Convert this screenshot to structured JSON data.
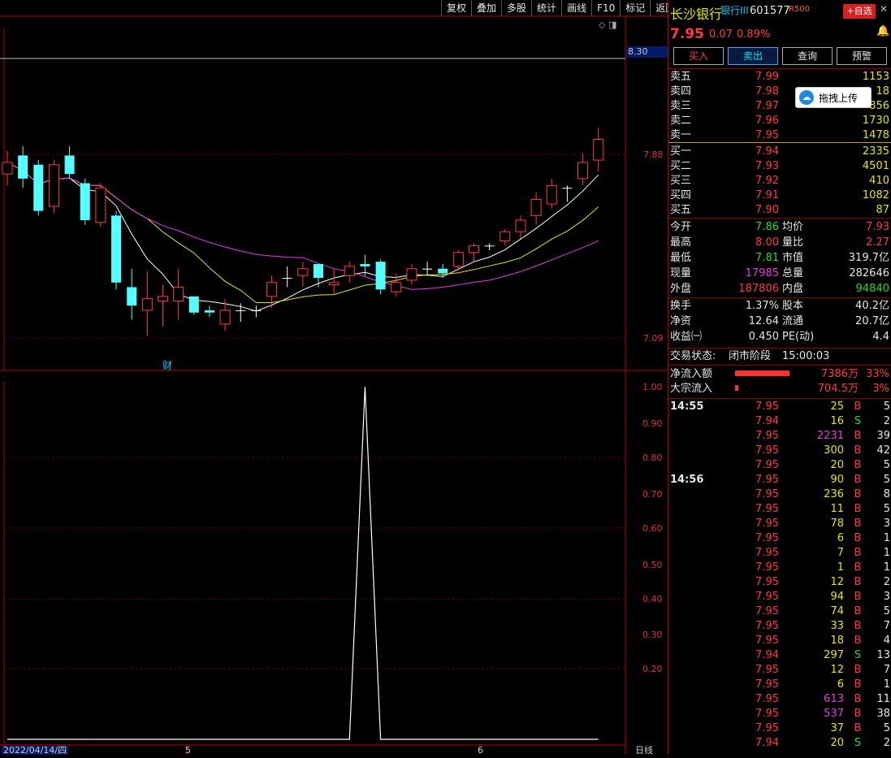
{
  "toolbar": [
    "复权",
    "叠加",
    "多股",
    "统计",
    "画线",
    "F10",
    "标记",
    "返回"
  ],
  "chart": {
    "price_axis": [
      "8.30",
      "7.88",
      "7.09"
    ],
    "indicator_axis": [
      "1.00",
      "0.90",
      "0.80",
      "0.70",
      "0.60",
      "0.50",
      "0.40",
      "0.30",
      "0.20"
    ],
    "date_label": "2022/04/14/四",
    "month_labels": [
      "5",
      "6"
    ],
    "finance_marker": "财",
    "period": "日线",
    "current_price_tag": "8.30"
  },
  "chart_data": {
    "type": "candlestick",
    "candles": [
      {
        "o": 7.8,
        "c": 7.85,
        "h": 7.9,
        "l": 7.75
      },
      {
        "o": 7.88,
        "c": 7.78,
        "h": 7.92,
        "l": 7.74
      },
      {
        "o": 7.84,
        "c": 7.64,
        "h": 7.86,
        "l": 7.62
      },
      {
        "o": 7.66,
        "c": 7.84,
        "h": 7.86,
        "l": 7.63
      },
      {
        "o": 7.88,
        "c": 7.8,
        "h": 7.92,
        "l": 7.78
      },
      {
        "o": 7.76,
        "c": 7.6,
        "h": 7.78,
        "l": 7.58
      },
      {
        "o": 7.59,
        "c": 7.74,
        "h": 7.76,
        "l": 7.57
      },
      {
        "o": 7.62,
        "c": 7.33,
        "h": 7.64,
        "l": 7.3
      },
      {
        "o": 7.31,
        "c": 7.23,
        "h": 7.39,
        "l": 7.17
      },
      {
        "o": 7.21,
        "c": 7.26,
        "h": 7.38,
        "l": 7.1
      },
      {
        "o": 7.25,
        "c": 7.27,
        "h": 7.32,
        "l": 7.14
      },
      {
        "o": 7.25,
        "c": 7.31,
        "h": 7.39,
        "l": 7.17
      },
      {
        "o": 7.27,
        "c": 7.2,
        "h": 7.27,
        "l": 7.19
      },
      {
        "o": 7.21,
        "c": 7.2,
        "h": 7.23,
        "l": 7.18
      },
      {
        "o": 7.15,
        "c": 7.21,
        "h": 7.26,
        "l": 7.12
      },
      {
        "o": 7.21,
        "c": 7.21,
        "h": 7.24,
        "l": 7.16
      },
      {
        "o": 7.21,
        "c": 7.21,
        "h": 7.23,
        "l": 7.18
      },
      {
        "o": 7.27,
        "c": 7.33,
        "h": 7.36,
        "l": 7.22
      },
      {
        "o": 7.35,
        "c": 7.35,
        "h": 7.4,
        "l": 7.31
      },
      {
        "o": 7.36,
        "c": 7.39,
        "h": 7.42,
        "l": 7.31
      },
      {
        "o": 7.41,
        "c": 7.35,
        "h": 7.41,
        "l": 7.31
      },
      {
        "o": 7.32,
        "c": 7.33,
        "h": 7.39,
        "l": 7.28
      },
      {
        "o": 7.36,
        "c": 7.4,
        "h": 7.42,
        "l": 7.33
      },
      {
        "o": 7.41,
        "c": 7.4,
        "h": 7.45,
        "l": 7.36
      },
      {
        "o": 7.42,
        "c": 7.3,
        "h": 7.43,
        "l": 7.28
      },
      {
        "o": 7.29,
        "c": 7.33,
        "h": 7.37,
        "l": 7.27
      },
      {
        "o": 7.34,
        "c": 7.39,
        "h": 7.41,
        "l": 7.32
      },
      {
        "o": 7.39,
        "c": 7.39,
        "h": 7.42,
        "l": 7.36
      },
      {
        "o": 7.39,
        "c": 7.37,
        "h": 7.41,
        "l": 7.35
      },
      {
        "o": 7.4,
        "c": 7.46,
        "h": 7.47,
        "l": 7.38
      },
      {
        "o": 7.46,
        "c": 7.49,
        "h": 7.5,
        "l": 7.42
      },
      {
        "o": 7.49,
        "c": 7.49,
        "h": 7.5,
        "l": 7.47
      },
      {
        "o": 7.51,
        "c": 7.55,
        "h": 7.56,
        "l": 7.49
      },
      {
        "o": 7.55,
        "c": 7.6,
        "h": 7.62,
        "l": 7.52
      },
      {
        "o": 7.62,
        "c": 7.69,
        "h": 7.72,
        "l": 7.58
      },
      {
        "o": 7.67,
        "c": 7.75,
        "h": 7.78,
        "l": 7.65
      },
      {
        "o": 7.74,
        "c": 7.74,
        "h": 7.75,
        "l": 7.68
      },
      {
        "o": 7.78,
        "c": 7.85,
        "h": 7.89,
        "l": 7.75
      },
      {
        "o": 7.86,
        "c": 7.95,
        "h": 8.0,
        "l": 7.81
      }
    ],
    "indicator": {
      "min": 0,
      "max": 1.0,
      "values": [
        0,
        0,
        0,
        0,
        0,
        0,
        0,
        0,
        0,
        0,
        0,
        0,
        0,
        0,
        0,
        0,
        0,
        0,
        0,
        0,
        0,
        0,
        0,
        1,
        0,
        0,
        0,
        0,
        0,
        0,
        0,
        0,
        0,
        0,
        0,
        0,
        0,
        0,
        0
      ]
    }
  },
  "stock": {
    "name": "长沙银行",
    "sector": "银行III",
    "code": "601577",
    "rank": "R500",
    "add_fav": "+自选",
    "price": "7.95",
    "change": "0.07",
    "change_pct": "0.89%"
  },
  "buttons": [
    "买入",
    "卖出",
    "查询",
    "预警"
  ],
  "upload": "拖拽上传",
  "asks": [
    {
      "label": "卖五",
      "price": "7.99",
      "vol": "1153"
    },
    {
      "label": "卖四",
      "price": "7.98",
      "vol": "18"
    },
    {
      "label": "卖三",
      "price": "7.97",
      "vol": "856"
    },
    {
      "label": "卖二",
      "price": "7.96",
      "vol": "1730"
    },
    {
      "label": "卖一",
      "price": "7.95",
      "vol": "1478"
    }
  ],
  "bids": [
    {
      "label": "买一",
      "price": "7.94",
      "vol": "2335"
    },
    {
      "label": "买二",
      "price": "7.93",
      "vol": "4501"
    },
    {
      "label": "买三",
      "price": "7.92",
      "vol": "410"
    },
    {
      "label": "买四",
      "price": "7.91",
      "vol": "1082"
    },
    {
      "label": "买五",
      "price": "7.90",
      "vol": "87"
    }
  ],
  "stats1": [
    {
      "l1": "今开",
      "v1": "7.86",
      "c1": "green",
      "l2": "均价",
      "v2": "7.93",
      "c2": "red"
    },
    {
      "l1": "最高",
      "v1": "8.00",
      "c1": "red",
      "l2": "量比",
      "v2": "2.27",
      "c2": "red"
    },
    {
      "l1": "最低",
      "v1": "7.81",
      "c1": "green",
      "l2": "市值",
      "v2": "319.7亿",
      "c2": "white"
    },
    {
      "l1": "现量",
      "v1": "17985",
      "c1": "magenta",
      "l2": "总量",
      "v2": "282646",
      "c2": "white"
    },
    {
      "l1": "外盘",
      "v1": "187806",
      "c1": "red",
      "l2": "内盘",
      "v2": "94840",
      "c2": "green"
    }
  ],
  "stats2": [
    {
      "l1": "换手",
      "v1": "1.37%",
      "l2": "股本",
      "v2": "40.2亿"
    },
    {
      "l1": "净资",
      "v1": "12.64",
      "l2": "流通",
      "v2": "20.7亿"
    },
    {
      "l1": "收益㈠",
      "v1": "0.450",
      "l2": "PE(动)",
      "v2": "4.4"
    }
  ],
  "trade_status": {
    "label": "交易状态:",
    "phase": "闭市阶段",
    "time": "15:00:03"
  },
  "flows": [
    {
      "label": "净流入额",
      "value": "7386万",
      "pct": "33%",
      "bar": 0.95
    },
    {
      "label": "大宗流入",
      "value": "704.5万",
      "pct": "3%",
      "bar": 0.05
    }
  ],
  "ticks": [
    {
      "t": "14:55",
      "p": "7.95",
      "v": "25",
      "vc": "yellow",
      "bs": "B",
      "n": "5"
    },
    {
      "t": "",
      "p": "7.94",
      "v": "16",
      "vc": "yellow",
      "bs": "S",
      "n": "2"
    },
    {
      "t": "",
      "p": "7.95",
      "v": "2231",
      "vc": "magenta",
      "bs": "B",
      "n": "39"
    },
    {
      "t": "",
      "p": "7.95",
      "v": "300",
      "vc": "yellow",
      "bs": "B",
      "n": "42"
    },
    {
      "t": "",
      "p": "7.95",
      "v": "20",
      "vc": "yellow",
      "bs": "B",
      "n": "5"
    },
    {
      "t": "14:56",
      "p": "7.95",
      "v": "90",
      "vc": "yellow",
      "bs": "B",
      "n": "5"
    },
    {
      "t": "",
      "p": "7.95",
      "v": "236",
      "vc": "yellow",
      "bs": "B",
      "n": "8"
    },
    {
      "t": "",
      "p": "7.95",
      "v": "11",
      "vc": "yellow",
      "bs": "B",
      "n": "5"
    },
    {
      "t": "",
      "p": "7.95",
      "v": "78",
      "vc": "yellow",
      "bs": "B",
      "n": "3"
    },
    {
      "t": "",
      "p": "7.95",
      "v": "6",
      "vc": "yellow",
      "bs": "B",
      "n": "1"
    },
    {
      "t": "",
      "p": "7.95",
      "v": "7",
      "vc": "yellow",
      "bs": "B",
      "n": "1"
    },
    {
      "t": "",
      "p": "7.95",
      "v": "1",
      "vc": "yellow",
      "bs": "B",
      "n": "1"
    },
    {
      "t": "",
      "p": "7.95",
      "v": "12",
      "vc": "yellow",
      "bs": "B",
      "n": "2"
    },
    {
      "t": "",
      "p": "7.95",
      "v": "94",
      "vc": "yellow",
      "bs": "B",
      "n": "3"
    },
    {
      "t": "",
      "p": "7.95",
      "v": "74",
      "vc": "yellow",
      "bs": "B",
      "n": "5"
    },
    {
      "t": "",
      "p": "7.95",
      "v": "33",
      "vc": "yellow",
      "bs": "B",
      "n": "7"
    },
    {
      "t": "",
      "p": "7.95",
      "v": "18",
      "vc": "yellow",
      "bs": "B",
      "n": "4"
    },
    {
      "t": "",
      "p": "7.94",
      "v": "297",
      "vc": "yellow",
      "bs": "S",
      "n": "13"
    },
    {
      "t": "",
      "p": "7.95",
      "v": "12",
      "vc": "yellow",
      "bs": "B",
      "n": "7"
    },
    {
      "t": "",
      "p": "7.95",
      "v": "6",
      "vc": "yellow",
      "bs": "B",
      "n": "1"
    },
    {
      "t": "",
      "p": "7.95",
      "v": "613",
      "vc": "magenta",
      "bs": "B",
      "n": "11"
    },
    {
      "t": "",
      "p": "7.95",
      "v": "537",
      "vc": "magenta",
      "bs": "B",
      "n": "38"
    },
    {
      "t": "",
      "p": "7.95",
      "v": "37",
      "vc": "yellow",
      "bs": "B",
      "n": "5"
    },
    {
      "t": "",
      "p": "7.94",
      "v": "20",
      "vc": "yellow",
      "bs": "S",
      "n": "2"
    }
  ]
}
